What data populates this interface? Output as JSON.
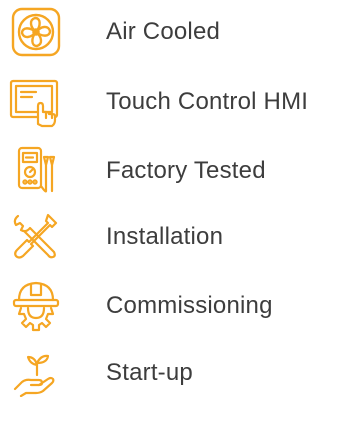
{
  "features": [
    {
      "icon": "fan-icon",
      "label": "Air Cooled"
    },
    {
      "icon": "touchscreen-icon",
      "label": "Touch Control HMI"
    },
    {
      "icon": "multimeter-icon",
      "label": "Factory Tested"
    },
    {
      "icon": "tools-icon",
      "label": "Installation"
    },
    {
      "icon": "hardhat-gear-icon",
      "label": "Commissioning"
    },
    {
      "icon": "hand-plant-icon",
      "label": "Start-up"
    }
  ],
  "colors": {
    "accent": "#F5A623",
    "text": "#3D3D3D"
  }
}
